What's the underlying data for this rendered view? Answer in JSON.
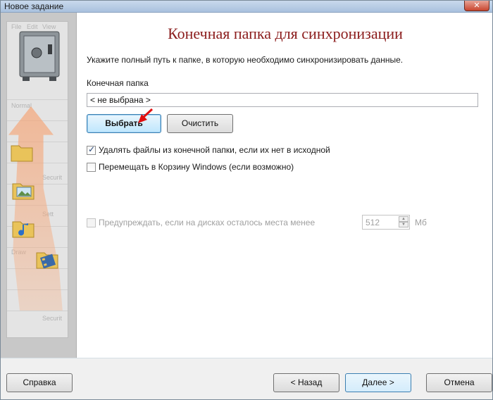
{
  "window": {
    "title": "Новое задание",
    "close_glyph": "✕"
  },
  "banner": {
    "ghost_labels": [
      "File",
      "Edit",
      "View",
      "Normal",
      "Securit",
      "Sett",
      "Draw",
      "Securit"
    ]
  },
  "main": {
    "heading": "Конечная папка для синхронизации",
    "description": "Укажите полный путь к папке, в которую необходимо синхронизировать данные.",
    "folder_label": "Конечная папка",
    "folder_value": "< не выбрана >",
    "choose_button": "Выбрать",
    "clear_button": "Очистить",
    "delete_option": {
      "label": "Удалять файлы из конечной папки, если их нет в исходной",
      "checked": true
    },
    "recycle_option": {
      "label": "Перемещать в Корзину Windows (если возможно)",
      "checked": false
    },
    "warn_option": {
      "label": "Предупреждать, если на дисках осталось места менее",
      "checked": false,
      "enabled": false
    },
    "space_value": "512",
    "space_unit": "Мб"
  },
  "footer": {
    "help_button": "Справка",
    "back_button": "< Назад",
    "next_button": "Далее >",
    "cancel_button": "Отмена"
  },
  "colors": {
    "heading": "#8b1c1c",
    "accent": "#3c7fb1",
    "annotation_arrow": "#e01010"
  },
  "icons": [
    "close-icon",
    "safe-icon",
    "folder-icon",
    "picture-folder-icon",
    "music-folder-icon",
    "video-folder-icon",
    "red-pointer-arrow-icon",
    "spin-up-icon",
    "spin-down-icon"
  ]
}
